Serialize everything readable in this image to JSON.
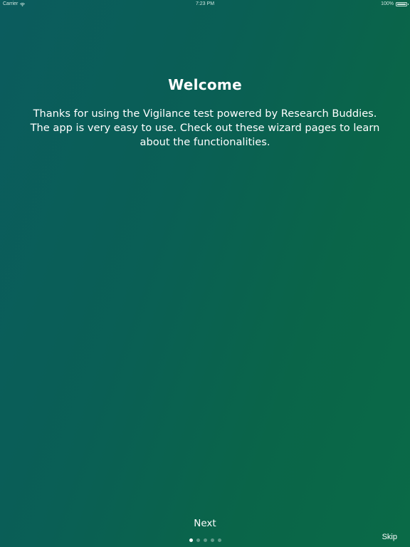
{
  "status_bar": {
    "carrier": "Carrier",
    "time": "7:23 PM",
    "battery": "100%"
  },
  "onboarding": {
    "title": "Welcome",
    "description": "Thanks for using the Vigilance test powered by Research Buddies. The app is very easy to use. Check out these wizard pages to learn about the functionalities.",
    "next_label": "Next",
    "skip_label": "Skip",
    "page_count": 5,
    "current_page": 1
  },
  "colors": {
    "gradient_start": "#0b5c5e",
    "gradient_end": "#0a6a47",
    "text": "#ffffff"
  }
}
